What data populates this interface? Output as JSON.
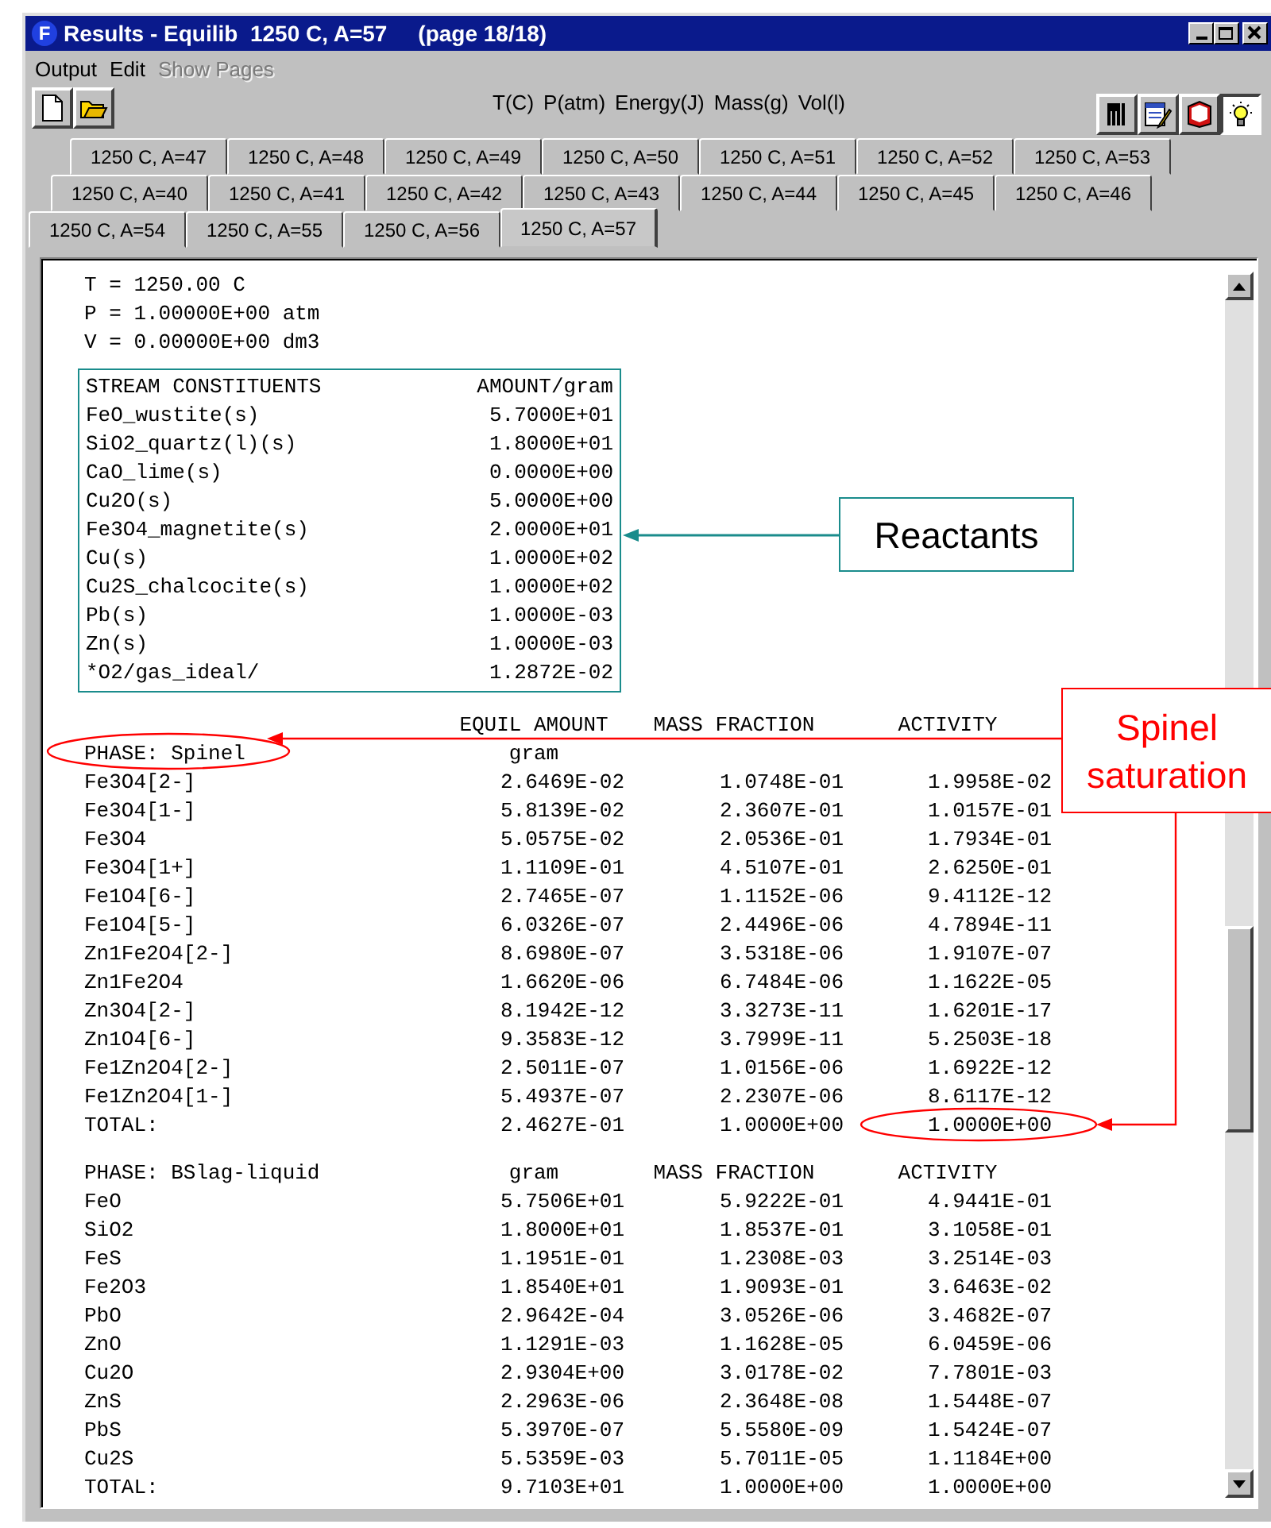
{
  "window": {
    "icon_letter": "F",
    "title": "Results - Equilib  1250 C, A=57     (page 18/18)"
  },
  "menu": [
    {
      "label": "Output",
      "disabled": false
    },
    {
      "label": "Edit",
      "disabled": false
    },
    {
      "label": "Show Pages",
      "disabled": true
    }
  ],
  "toolbar": {
    "units": [
      "T(C)",
      "P(atm)",
      "Energy(J)",
      "Mass(g)",
      "Vol(l)"
    ]
  },
  "tab_rows": [
    [
      {
        "label": "1250 C, A=47",
        "selected": false
      },
      {
        "label": "1250 C, A=48",
        "selected": false
      },
      {
        "label": "1250 C, A=49",
        "selected": false
      },
      {
        "label": "1250 C, A=50",
        "selected": false
      },
      {
        "label": "1250 C, A=51",
        "selected": false
      },
      {
        "label": "1250 C, A=52",
        "selected": false
      },
      {
        "label": "1250 C, A=53",
        "selected": false
      }
    ],
    [
      {
        "label": "1250 C, A=40",
        "selected": false
      },
      {
        "label": "1250 C, A=41",
        "selected": false
      },
      {
        "label": "1250 C, A=42",
        "selected": false
      },
      {
        "label": "1250 C, A=43",
        "selected": false
      },
      {
        "label": "1250 C, A=44",
        "selected": false
      },
      {
        "label": "1250 C, A=45",
        "selected": false
      },
      {
        "label": "1250 C, A=46",
        "selected": false
      }
    ],
    [
      {
        "label": "1250 C, A=54",
        "selected": false
      },
      {
        "label": "1250 C, A=55",
        "selected": false
      },
      {
        "label": "1250 C, A=56",
        "selected": false
      },
      {
        "label": "1250 C, A=57",
        "selected": true
      }
    ]
  ],
  "conditions": [
    "T = 1250.00 C",
    "P = 1.00000E+00 atm",
    "V = 0.00000E+00 dm3"
  ],
  "stream": {
    "columns": [
      "STREAM CONSTITUENTS",
      "AMOUNT/gram"
    ],
    "rows": [
      {
        "name": "FeO_wustite(s)",
        "amount": "5.7000E+01"
      },
      {
        "name": "SiO2_quartz(l)(s)",
        "amount": "1.8000E+01"
      },
      {
        "name": "CaO_lime(s)",
        "amount": "0.0000E+00"
      },
      {
        "name": "Cu2O(s)",
        "amount": "5.0000E+00"
      },
      {
        "name": "Fe3O4_magnetite(s)",
        "amount": "2.0000E+01"
      },
      {
        "name": "Cu(s)",
        "amount": "1.0000E+02"
      },
      {
        "name": "Cu2S_chalcocite(s)",
        "amount": "1.0000E+02"
      },
      {
        "name": "Pb(s)",
        "amount": "1.0000E-03"
      },
      {
        "name": "Zn(s)",
        "amount": "1.0000E-03"
      },
      {
        "name": "*O2/gas_ideal/",
        "amount": "1.2872E-02"
      }
    ]
  },
  "phases": [
    {
      "headers": [
        "EQUIL AMOUNT",
        "MASS FRACTION",
        "ACTIVITY"
      ],
      "title": "PHASE: Spinel",
      "title_columns": [
        "gram"
      ],
      "rows": [
        {
          "species": "Fe3O4[2-]",
          "amount": "2.6469E-02",
          "mass_fraction": "1.0748E-01",
          "activity": "1.9958E-02"
        },
        {
          "species": "Fe3O4[1-]",
          "amount": "5.8139E-02",
          "mass_fraction": "2.3607E-01",
          "activity": "1.0157E-01"
        },
        {
          "species": "Fe3O4",
          "amount": "5.0575E-02",
          "mass_fraction": "2.0536E-01",
          "activity": "1.7934E-01"
        },
        {
          "species": "Fe3O4[1+]",
          "amount": "1.1109E-01",
          "mass_fraction": "4.5107E-01",
          "activity": "2.6250E-01"
        },
        {
          "species": "Fe1O4[6-]",
          "amount": "2.7465E-07",
          "mass_fraction": "1.1152E-06",
          "activity": "9.4112E-12"
        },
        {
          "species": "Fe1O4[5-]",
          "amount": "6.0326E-07",
          "mass_fraction": "2.4496E-06",
          "activity": "4.7894E-11"
        },
        {
          "species": "Zn1Fe2O4[2-]",
          "amount": "8.6980E-07",
          "mass_fraction": "3.5318E-06",
          "activity": "1.9107E-07"
        },
        {
          "species": "Zn1Fe2O4",
          "amount": "1.6620E-06",
          "mass_fraction": "6.7484E-06",
          "activity": "1.1622E-05"
        },
        {
          "species": "Zn3O4[2-]",
          "amount": "8.1942E-12",
          "mass_fraction": "3.3273E-11",
          "activity": "1.6201E-17"
        },
        {
          "species": "Zn1O4[6-]",
          "amount": "9.3583E-12",
          "mass_fraction": "3.7999E-11",
          "activity": "5.2503E-18"
        },
        {
          "species": "Fe1Zn2O4[2-]",
          "amount": "2.5011E-07",
          "mass_fraction": "1.0156E-06",
          "activity": "1.6922E-12"
        },
        {
          "species": "Fe1Zn2O4[1-]",
          "amount": "5.4937E-07",
          "mass_fraction": "2.2307E-06",
          "activity": "8.6117E-12"
        },
        {
          "species": "TOTAL:",
          "amount": "2.4627E-01",
          "mass_fraction": "1.0000E+00",
          "activity": "1.0000E+00"
        }
      ]
    },
    {
      "title": "PHASE: BSlag-liquid",
      "title_columns": [
        "gram",
        "MASS FRACTION",
        "ACTIVITY"
      ],
      "rows": [
        {
          "species": "FeO",
          "amount": "5.7506E+01",
          "mass_fraction": "5.9222E-01",
          "activity": "4.9441E-01"
        },
        {
          "species": "SiO2",
          "amount": "1.8000E+01",
          "mass_fraction": "1.8537E-01",
          "activity": "3.1058E-01"
        },
        {
          "species": "FeS",
          "amount": "1.1951E-01",
          "mass_fraction": "1.2308E-03",
          "activity": "3.2514E-03"
        },
        {
          "species": "Fe2O3",
          "amount": "1.8540E+01",
          "mass_fraction": "1.9093E-01",
          "activity": "3.6463E-02"
        },
        {
          "species": "PbO",
          "amount": "2.9642E-04",
          "mass_fraction": "3.0526E-06",
          "activity": "3.4682E-07"
        },
        {
          "species": "ZnO",
          "amount": "1.1291E-03",
          "mass_fraction": "1.1628E-05",
          "activity": "6.0459E-06"
        },
        {
          "species": "Cu2O",
          "amount": "2.9304E+00",
          "mass_fraction": "3.0178E-02",
          "activity": "7.7801E-03"
        },
        {
          "species": "ZnS",
          "amount": "2.2963E-06",
          "mass_fraction": "2.3648E-08",
          "activity": "1.5448E-07"
        },
        {
          "species": "PbS",
          "amount": "5.3970E-07",
          "mass_fraction": "5.5580E-09",
          "activity": "1.5424E-07"
        },
        {
          "species": "Cu2S",
          "amount": "5.5359E-03",
          "mass_fraction": "5.7011E-05",
          "activity": "1.1184E+00"
        },
        {
          "species": "TOTAL:",
          "amount": "9.7103E+01",
          "mass_fraction": "1.0000E+00",
          "activity": "1.0000E+00"
        }
      ]
    }
  ],
  "annotations": [
    {
      "text": "Reactants",
      "color": "#1a8c8c"
    },
    {
      "text": "Spinel saturation",
      "color": "#ff0000"
    }
  ]
}
